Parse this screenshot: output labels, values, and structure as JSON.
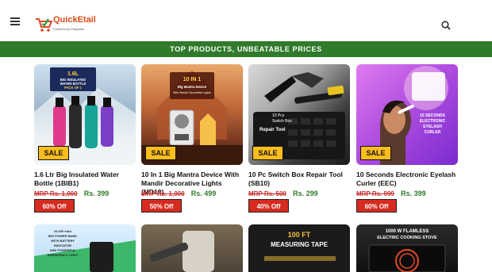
{
  "header": {
    "logo_text": "QuickEtail",
    "logo_tagline": "Powered by Pazpaisa"
  },
  "banner": {
    "text": "TOP PRODUCTS, UNBEATABLE PRICES"
  },
  "products": [
    {
      "badge": "SALE",
      "title": "1.6 Ltr Big Insulated Water Bottle (1BIB1)",
      "mrp": "MRP Rs. 1,000",
      "price": "Rs. 399",
      "discount": "60% Off",
      "image_text": [
        "1.6L",
        "BIG INSULATED",
        "WATER BOTTLE",
        "PACK OF 1"
      ]
    },
    {
      "badge": "SALE",
      "title": "10 In 1 Big Mantra Device With Mandir Decorative Lights (MD19)",
      "mrp": "MRP Rs. 1,000",
      "price": "Rs. 499",
      "discount": "50% Off",
      "image_text": [
        "10 IN 1",
        "Big Mantra Device",
        "With Mandir Decorative Lights"
      ]
    },
    {
      "badge": "SALE",
      "title": "10 Pc Switch Box Repair Tool (SB10)",
      "mrp": "MRP Rs. 500",
      "price": "Rs. 299",
      "discount": "40% Off",
      "image_text": [
        "10 Pcs",
        "Switch Box",
        "Repair Tool"
      ]
    },
    {
      "badge": "SALE",
      "title": "10 Seconds Electronic Eyelash Curler (EEC)",
      "mrp": "MRP Rs. 999",
      "price": "Rs. 399",
      "discount": "60% Off",
      "image_text": [
        "10 SECONDS",
        "ELECTRONIC",
        "EYELASH",
        "CURLER"
      ]
    }
  ],
  "row2": [
    {
      "image_text": [
        "10,000 mAh",
        "BIG POWER BANK",
        "WITH BATTERY",
        "INDICATOR",
        "AND POWERFUL",
        "EMERGENCY LIGHT"
      ]
    },
    {
      "image_text": []
    },
    {
      "image_text": [
        "100 FT",
        "MEASURING TAPE"
      ]
    },
    {
      "image_text": [
        "1000 W FLAMLESS",
        "ELECTRIC COOKING STOVE"
      ]
    }
  ]
}
